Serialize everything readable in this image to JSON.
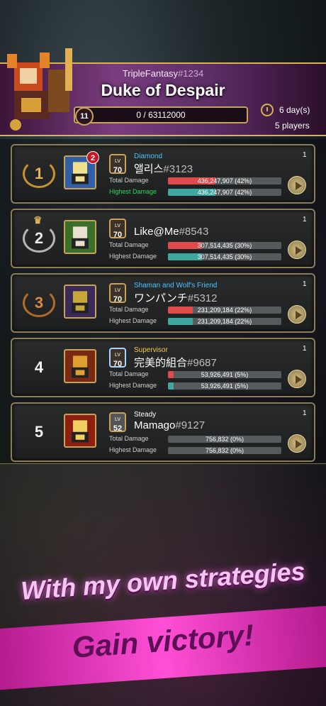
{
  "raid": {
    "owner_name": "TripleFantasy",
    "owner_tag": "#1234",
    "title": "Duke of Despair",
    "level": "11",
    "hp_text": "0 / 63112000",
    "days_left": "6 day(s)",
    "players": "5 players"
  },
  "rows": [
    {
      "rank": "1",
      "badge": "2",
      "lv": "70",
      "title": "Diamond",
      "title_color": "#4fc2ff",
      "name": "앨리스",
      "tag": "#3123",
      "total_label": "Total Damage",
      "total": "436,247,907 (42%)",
      "total_frac": 0.42,
      "highest_label": "Highest Damage",
      "highest": "436,247,907 (42%)",
      "highest_frac": 0.42,
      "tries": "1"
    },
    {
      "rank": "2",
      "badge": "",
      "lv": "70",
      "title": "",
      "title_color": "#ffffff",
      "name": "Like@Me",
      "tag": "#8543",
      "total_label": "Total Damage",
      "total": "307,514,435 (30%)",
      "total_frac": 0.3,
      "highest_label": "Highest Damage",
      "highest": "307,514,435 (30%)",
      "highest_frac": 0.3,
      "tries": "1"
    },
    {
      "rank": "3",
      "badge": "",
      "lv": "70",
      "title": "Shaman and Wolf's Friend",
      "title_color": "#4fc2ff",
      "name": "ワンパンチ",
      "tag": "#5312",
      "total_label": "Total Damage",
      "total": "231,209,184 (22%)",
      "total_frac": 0.22,
      "highest_label": "Highest Damage",
      "highest": "231,209,184 (22%)",
      "highest_frac": 0.22,
      "tries": "1"
    },
    {
      "rank": "4",
      "badge": "",
      "lv": "70",
      "title": "Supervisor",
      "title_color": "#f2c94c",
      "name": "完美的組合",
      "tag": "#9687",
      "total_label": "Total Damage",
      "total": "53,926,491 (5%)",
      "total_frac": 0.05,
      "highest_label": "Highest Damage",
      "highest": "53,926,491 (5%)",
      "highest_frac": 0.05,
      "tries": "1"
    },
    {
      "rank": "5",
      "badge": "",
      "lv": "52",
      "title": "Steady",
      "title_color": "#ffffff",
      "name": "Mamago",
      "tag": "#9127",
      "total_label": "Total Damage",
      "total": "756,832 (0%)",
      "total_frac": 0.0,
      "highest_label": "Highest Damage",
      "highest": "756,832 (0%)",
      "highest_frac": 0.0,
      "tries": "1"
    }
  ],
  "lv_label": "LV",
  "slogan": {
    "line1": "With my own strategies",
    "line2": "Gain victory!"
  },
  "colors": {
    "total_bar": "#e04a4a",
    "highest_bar": "#3fa6a0",
    "highest_label_first": "#29d65a",
    "gold": "#d6b25a"
  }
}
